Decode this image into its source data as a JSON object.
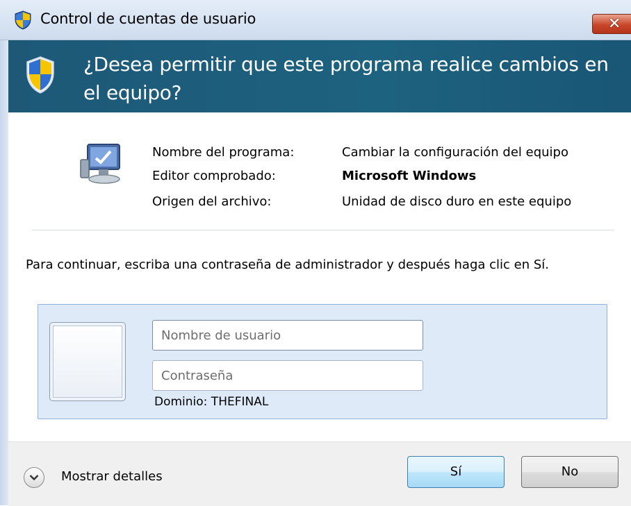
{
  "window": {
    "title": "Control de cuentas de usuario",
    "close_label": "✕",
    "icon": "uac-shield-icon"
  },
  "banner": {
    "question": "¿Desea permitir que este programa realice cambios en el equipo?",
    "icon": "uac-shield-icon"
  },
  "program_info": {
    "icon": "monitor-settings-icon",
    "rows": [
      {
        "label": "Nombre del programa:",
        "value": "Cambiar la configuración del equipo"
      },
      {
        "label": "Editor comprobado:",
        "value": "Microsoft Windows"
      },
      {
        "label": "Origen del archivo:",
        "value": "Unidad de disco duro en este equipo"
      }
    ]
  },
  "instruction": "Para continuar, escriba una contraseña de administrador y después haga clic en Sí.",
  "credentials": {
    "username_placeholder": "Nombre de usuario",
    "username_value": "",
    "password_placeholder": "Contraseña",
    "password_value": "",
    "domain": "Dominio: THEFINAL"
  },
  "footer": {
    "details_label": "Mostrar detalles",
    "yes_label": "Sí",
    "no_label": "No"
  },
  "colors": {
    "banner": "#1d5877",
    "credential_box": "#dfeaf8",
    "close_button": "#c9472b"
  }
}
